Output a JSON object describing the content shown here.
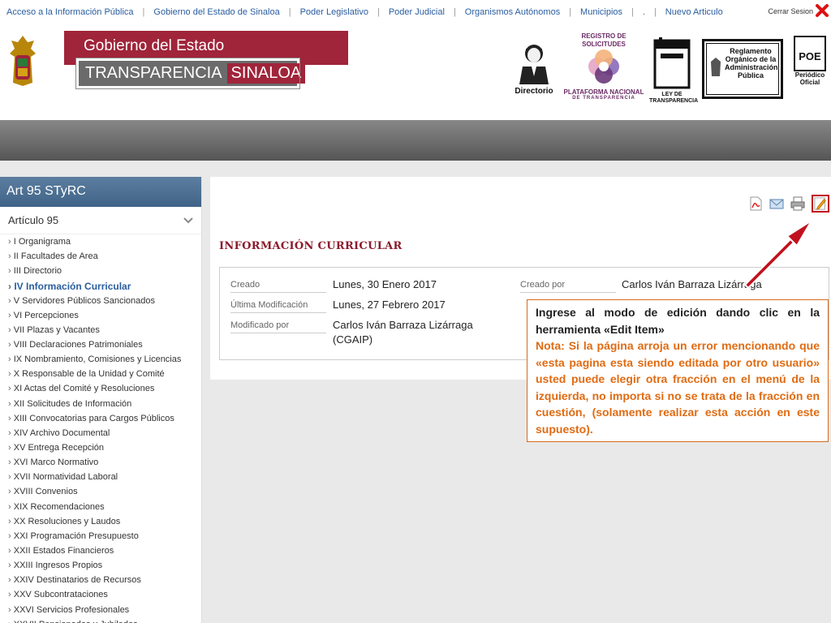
{
  "topnav": {
    "links": [
      "Acceso a la Información Pública",
      "Gobierno del Estado de Sinaloa",
      "Poder Legislativo",
      "Poder Judicial",
      "Organismos Autónomos",
      "Municipios",
      ".",
      "Nuevo Articulo"
    ],
    "logout": "Cerrar Sesion"
  },
  "brand": {
    "top": "Gobierno del Estado",
    "bottom_a": "TRANSPARENCIA",
    "bottom_b": "SINALOA"
  },
  "header_icons": {
    "directorio": "Directorio",
    "registro_title": "REGISTRO DE SOLICITUDES",
    "registro_platform": "PLATAFORMA NACIONAL",
    "registro_sub": "DE TRANSPARENCIA",
    "ley": "LEY DE TRANSPARENCIA",
    "reglamento": "Reglamento Orgánico de la Administración Pública",
    "poe": "POE",
    "poe_caption": "Periódico Oficial"
  },
  "sidebar": {
    "title": "Art 95 STyRC",
    "group": "Artículo 95",
    "items": [
      "I Organigrama",
      "II Facultades de Area",
      "III Directorio",
      "IV Información Curricular",
      "V Servidores Públicos Sancionados",
      "VI Percepciones",
      "VII Plazas y Vacantes",
      "VIII Declaraciones Patrimoniales",
      "IX Nombramiento, Comisiones y Licencias",
      "X Responsable de la Unidad y Comité",
      "XI Actas del Comité y Resoluciones",
      "XII Solicitudes de Información",
      "XIII Convocatorias para Cargos Públicos",
      "XIV Archivo Documental",
      "XV Entrega Recepción",
      "XVI Marco Normativo",
      "XVII Normatividad Laboral",
      "XVIII Convenios",
      "XIX Recomendaciones",
      "XX Resoluciones y Laudos",
      "XXI Programación Presupuesto",
      "XXII Estados Financieros",
      "XXIII Ingresos Propios",
      "XXIV Destinatarios de Recursos",
      "XXV Subcontrataciones",
      "XXVI Servicios Profesionales",
      "XXVII Pensionados y Jubilados"
    ],
    "active_index": 3
  },
  "content": {
    "title": "INFORMACIÓN CURRICULAR",
    "created_label": "Creado",
    "created_value": "Lunes, 30 Enero 2017",
    "modified_label": "Última Modificación",
    "modified_value": "Lunes, 27 Febrero 2017",
    "modified_by_label": "Modificado por",
    "modified_by_value": "Carlos Iván Barraza Lizárraga (CGAIP)",
    "created_by_label": "Creado por",
    "created_by_value": "Carlos Iván Barraza Lizárraga"
  },
  "callout": {
    "line_a": "Ingrese al modo de edición dando clic en la herramienta «Edit Item»",
    "line_b": "Nota: Si la página arroja un error mencionando que «esta pagina esta siendo editada por otro usuario» usted puede elegir otra fracción en el menú de la izquierda, no importa si no se trata de la fracción en cuestión, (solamente realizar esta acción en este supuesto)."
  },
  "colors": {
    "brand_red": "#a0243a",
    "link_blue": "#2a5d9f",
    "callout_orange": "#e06b12"
  }
}
